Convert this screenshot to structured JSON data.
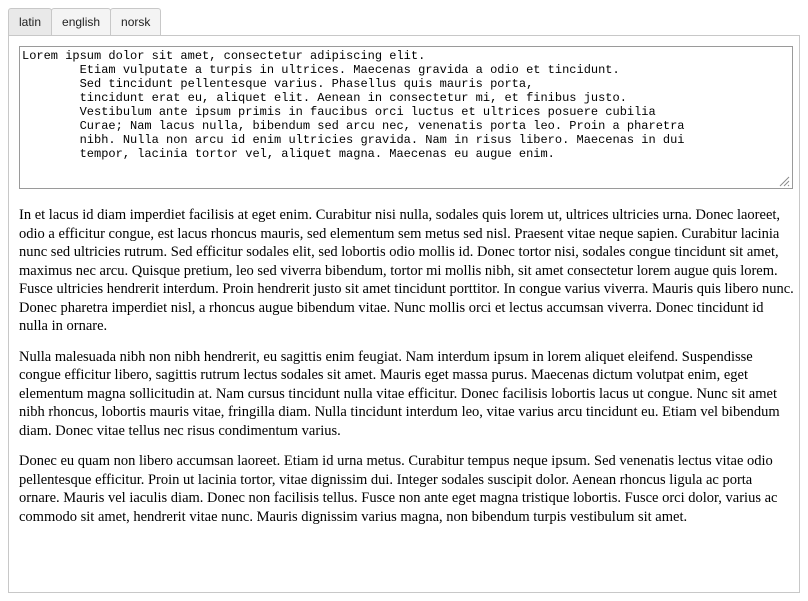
{
  "tabs": [
    {
      "label": "latin"
    },
    {
      "label": "english"
    },
    {
      "label": "norsk"
    }
  ],
  "editor": {
    "text": "Lorem ipsum dolor sit amet, consectetur adipiscing elit.\n        Etiam vulputate a turpis in ultrices. Maecenas gravida a odio et tincidunt.\n        Sed tincidunt pellentesque varius. Phasellus quis mauris porta,\n        tincidunt erat eu, aliquet elit. Aenean in consectetur mi, et finibus justo.\n        Vestibulum ante ipsum primis in faucibus orci luctus et ultrices posuere cubilia\n        Curae; Nam lacus nulla, bibendum sed arcu nec, venenatis porta leo. Proin a pharetra\n        nibh. Nulla non arcu id enim ultricies gravida. Nam in risus libero. Maecenas in dui\n        tempor, lacinia tortor vel, aliquet magna. Maecenas eu augue enim."
  },
  "paragraphs": [
    "In et lacus id diam imperdiet facilisis at eget enim. Curabitur nisi nulla, sodales quis lorem ut, ultrices ultricies urna. Donec laoreet, odio a efficitur congue, est lacus rhoncus mauris, sed elementum sem metus sed nisl. Praesent vitae neque sapien. Curabitur lacinia nunc sed ultricies rutrum. Sed efficitur sodales elit, sed lobortis odio mollis id. Donec tortor nisi, sodales congue tincidunt sit amet, maximus nec arcu. Quisque pretium, leo sed viverra bibendum, tortor mi mollis nibh, sit amet consectetur lorem augue quis lorem. Fusce ultricies hendrerit interdum. Proin hendrerit justo sit amet tincidunt porttitor. In congue varius viverra. Mauris quis libero nunc. Donec pharetra imperdiet nisl, a rhoncus augue bibendum vitae. Nunc mollis orci et lectus accumsan viverra. Donec tincidunt id nulla in ornare.",
    "Nulla malesuada nibh non nibh hendrerit, eu sagittis enim feugiat. Nam interdum ipsum in lorem aliquet eleifend. Suspendisse congue efficitur libero, sagittis rutrum lectus sodales sit amet. Mauris eget massa purus. Maecenas dictum volutpat enim, eget elementum magna sollicitudin at. Nam cursus tincidunt nulla vitae efficitur. Donec facilisis lobortis lacus ut congue. Nunc sit amet nibh rhoncus, lobortis mauris vitae, fringilla diam. Nulla tincidunt interdum leo, vitae varius arcu tincidunt eu. Etiam vel bibendum diam. Donec vitae tellus nec risus condimentum varius.",
    "Donec eu quam non libero accumsan laoreet. Etiam id urna metus. Curabitur tempus neque ipsum. Sed venenatis lectus vitae odio pellentesque efficitur. Proin ut lacinia tortor, vitae dignissim dui. Integer sodales suscipit dolor. Aenean rhoncus ligula ac porta ornare. Mauris vel iaculis diam. Donec non facilisis tellus. Fusce non ante eget magna tristique lobortis. Fusce orci dolor, varius ac commodo sit amet, hendrerit vitae nunc. Mauris dignissim varius magna, non bibendum turpis vestibulum sit amet."
  ],
  "icons": {
    "resize": "resize-grip-icon"
  }
}
